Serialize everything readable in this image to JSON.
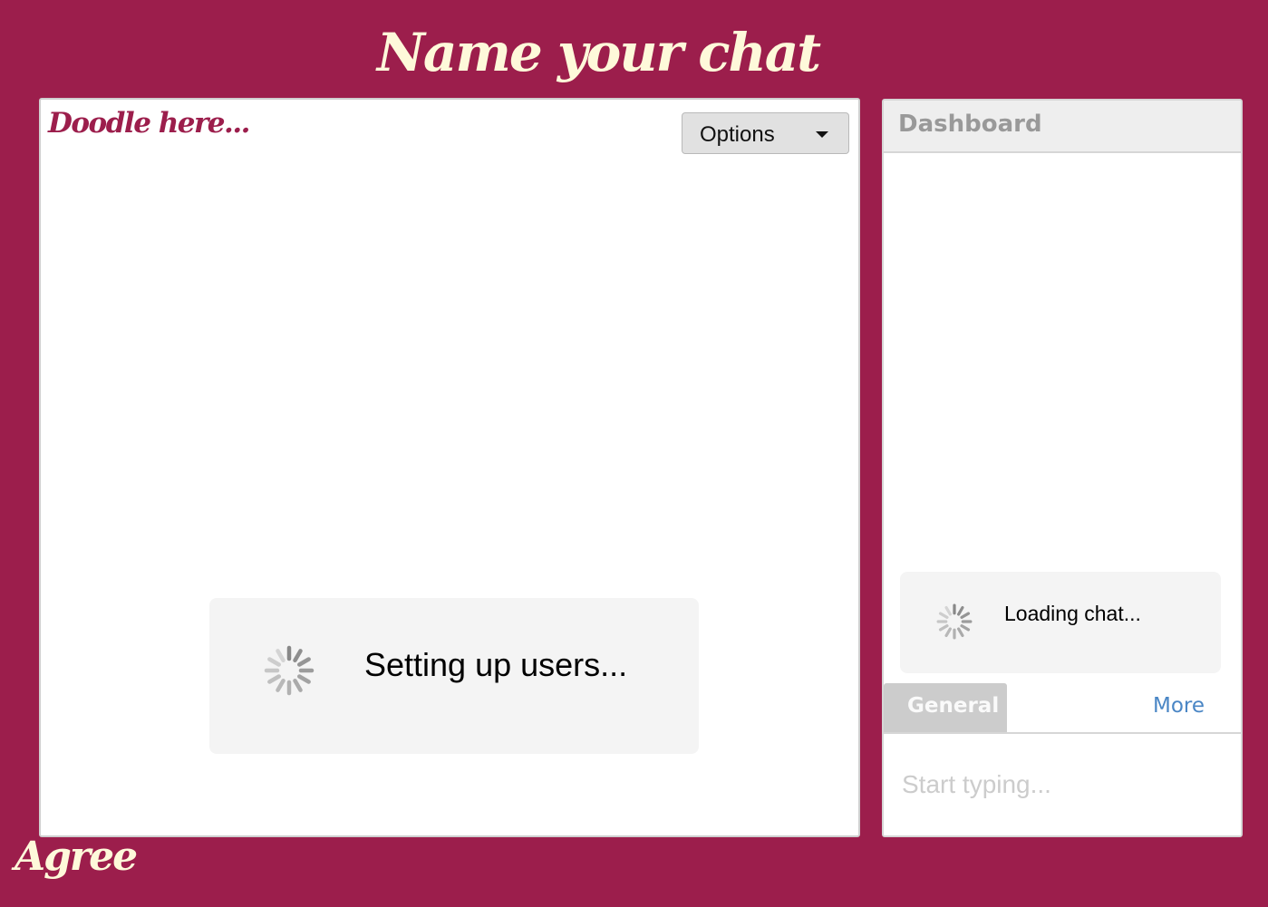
{
  "header": {
    "title": "Name your chat"
  },
  "canvas": {
    "label": "Doodle here...",
    "options_label": "Options",
    "status_text": "Setting up users..."
  },
  "dashboard": {
    "title": "Dashboard",
    "status_text": "Loading chat...",
    "tabs": [
      {
        "label": "General"
      },
      {
        "label": "More"
      }
    ],
    "input_placeholder": "Start typing..."
  },
  "footer": {
    "logo_text": "Agree"
  },
  "icons": {
    "options_dropdown": "caret-down-icon",
    "loading": "spinner-icon"
  },
  "colors": {
    "background": "#9c1e4c",
    "title_text": "#fef9da",
    "link_blue": "#4a86c5",
    "tab_gray": "#cccccc"
  }
}
